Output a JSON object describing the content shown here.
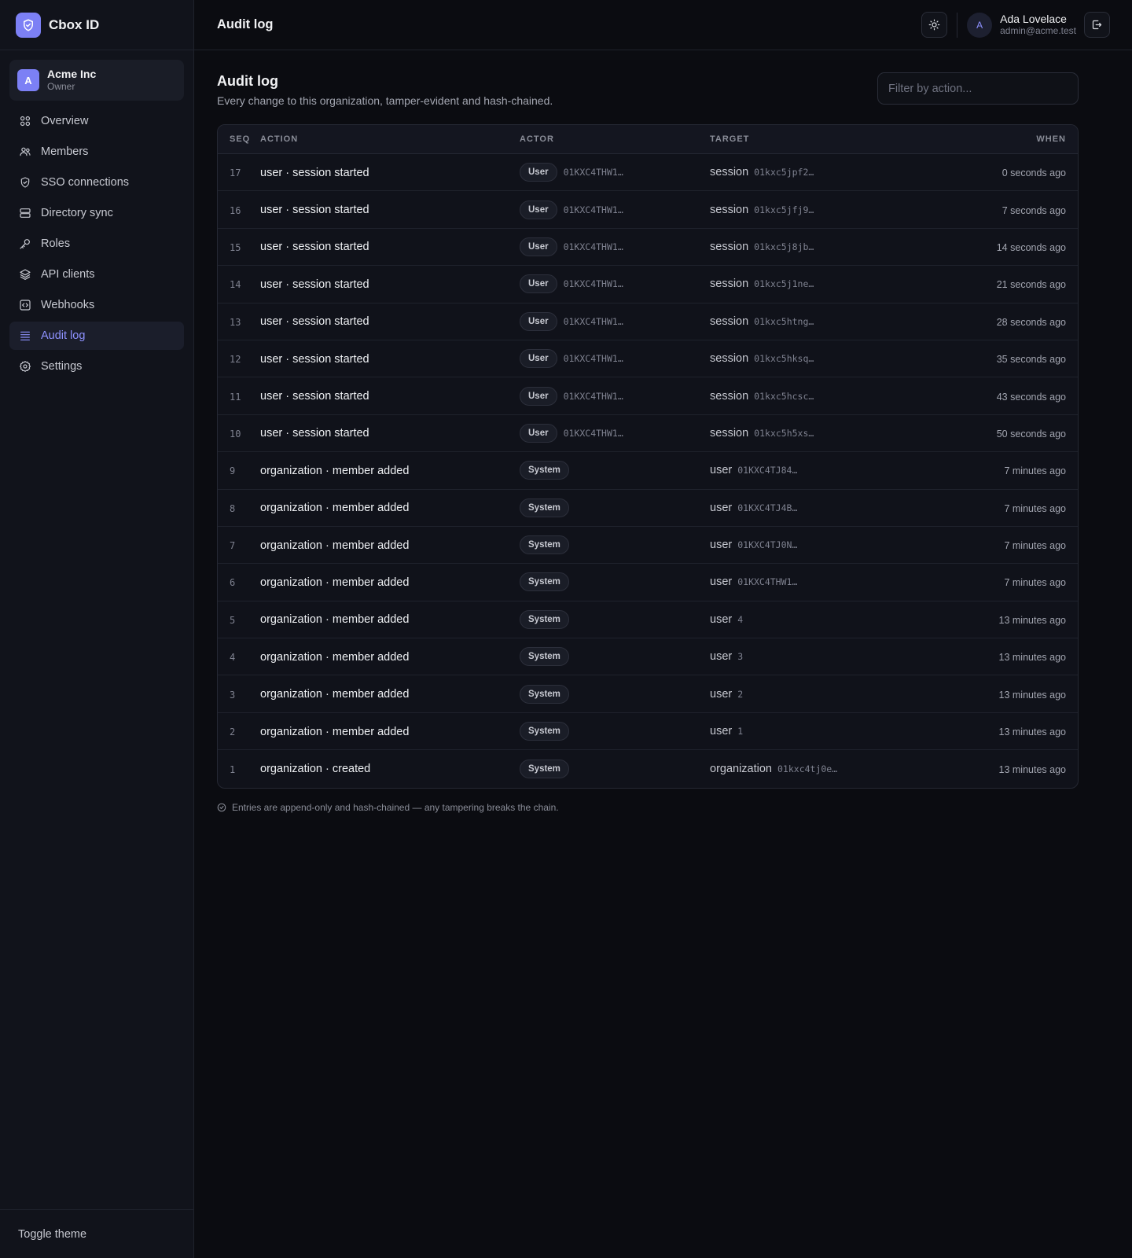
{
  "brand": {
    "name": "Cbox ID"
  },
  "org": {
    "initial": "A",
    "name": "Acme Inc",
    "role": "Owner"
  },
  "nav": [
    {
      "label": "Overview",
      "icon": "grid-icon"
    },
    {
      "label": "Members",
      "icon": "users-icon"
    },
    {
      "label": "SSO connections",
      "icon": "shield-icon"
    },
    {
      "label": "Directory sync",
      "icon": "database-icon"
    },
    {
      "label": "Roles",
      "icon": "key-icon"
    },
    {
      "label": "API clients",
      "icon": "layers-icon"
    },
    {
      "label": "Webhooks",
      "icon": "webhook-icon"
    },
    {
      "label": "Audit log",
      "icon": "list-icon",
      "active": true
    },
    {
      "label": "Settings",
      "icon": "gear-icon"
    }
  ],
  "sidebar_footer": {
    "toggle_theme": "Toggle theme"
  },
  "topbar": {
    "title": "Audit log",
    "user": {
      "initial": "A",
      "name": "Ada Lovelace",
      "email": "admin@acme.test"
    }
  },
  "page": {
    "title": "Audit log",
    "subtitle": "Every change to this organization, tamper-evident and hash-chained.",
    "filter_placeholder": "Filter by action..."
  },
  "table": {
    "headers": {
      "seq": "SEQ",
      "action": "ACTION",
      "actor": "ACTOR",
      "target": "TARGET",
      "when": "WHEN"
    },
    "rows": [
      {
        "seq": "17",
        "action": "user · session started",
        "actor_type": "User",
        "actor_id": "01KXC4THW1…",
        "target_kind": "session",
        "target_id": "01kxc5jpf2…",
        "when": "0 seconds ago"
      },
      {
        "seq": "16",
        "action": "user · session started",
        "actor_type": "User",
        "actor_id": "01KXC4THW1…",
        "target_kind": "session",
        "target_id": "01kxc5jfj9…",
        "when": "7 seconds ago"
      },
      {
        "seq": "15",
        "action": "user · session started",
        "actor_type": "User",
        "actor_id": "01KXC4THW1…",
        "target_kind": "session",
        "target_id": "01kxc5j8jb…",
        "when": "14 seconds ago"
      },
      {
        "seq": "14",
        "action": "user · session started",
        "actor_type": "User",
        "actor_id": "01KXC4THW1…",
        "target_kind": "session",
        "target_id": "01kxc5j1ne…",
        "when": "21 seconds ago"
      },
      {
        "seq": "13",
        "action": "user · session started",
        "actor_type": "User",
        "actor_id": "01KXC4THW1…",
        "target_kind": "session",
        "target_id": "01kxc5htng…",
        "when": "28 seconds ago"
      },
      {
        "seq": "12",
        "action": "user · session started",
        "actor_type": "User",
        "actor_id": "01KXC4THW1…",
        "target_kind": "session",
        "target_id": "01kxc5hksq…",
        "when": "35 seconds ago"
      },
      {
        "seq": "11",
        "action": "user · session started",
        "actor_type": "User",
        "actor_id": "01KXC4THW1…",
        "target_kind": "session",
        "target_id": "01kxc5hcsc…",
        "when": "43 seconds ago"
      },
      {
        "seq": "10",
        "action": "user · session started",
        "actor_type": "User",
        "actor_id": "01KXC4THW1…",
        "target_kind": "session",
        "target_id": "01kxc5h5xs…",
        "when": "50 seconds ago"
      },
      {
        "seq": "9",
        "action": "organization · member added",
        "actor_type": "System",
        "actor_id": "",
        "target_kind": "user",
        "target_id": "01KXC4TJ84…",
        "when": "7 minutes ago"
      },
      {
        "seq": "8",
        "action": "organization · member added",
        "actor_type": "System",
        "actor_id": "",
        "target_kind": "user",
        "target_id": "01KXC4TJ4B…",
        "when": "7 minutes ago"
      },
      {
        "seq": "7",
        "action": "organization · member added",
        "actor_type": "System",
        "actor_id": "",
        "target_kind": "user",
        "target_id": "01KXC4TJ0N…",
        "when": "7 minutes ago"
      },
      {
        "seq": "6",
        "action": "organization · member added",
        "actor_type": "System",
        "actor_id": "",
        "target_kind": "user",
        "target_id": "01KXC4THW1…",
        "when": "7 minutes ago"
      },
      {
        "seq": "5",
        "action": "organization · member added",
        "actor_type": "System",
        "actor_id": "",
        "target_kind": "user",
        "target_id": "4",
        "when": "13 minutes ago"
      },
      {
        "seq": "4",
        "action": "organization · member added",
        "actor_type": "System",
        "actor_id": "",
        "target_kind": "user",
        "target_id": "3",
        "when": "13 minutes ago"
      },
      {
        "seq": "3",
        "action": "organization · member added",
        "actor_type": "System",
        "actor_id": "",
        "target_kind": "user",
        "target_id": "2",
        "when": "13 minutes ago"
      },
      {
        "seq": "2",
        "action": "organization · member added",
        "actor_type": "System",
        "actor_id": "",
        "target_kind": "user",
        "target_id": "1",
        "when": "13 minutes ago"
      },
      {
        "seq": "1",
        "action": "organization · created",
        "actor_type": "System",
        "actor_id": "",
        "target_kind": "organization",
        "target_id": "01kxc4tj0e…",
        "when": "13 minutes ago"
      }
    ]
  },
  "footer_note": "Entries are append-only and hash-chained — any tampering breaks the chain.",
  "colors": {
    "accent": "#7c80f5",
    "active_nav_text": "#8e92ff",
    "background": "#0b0c11",
    "sidebar": "#11131b"
  }
}
